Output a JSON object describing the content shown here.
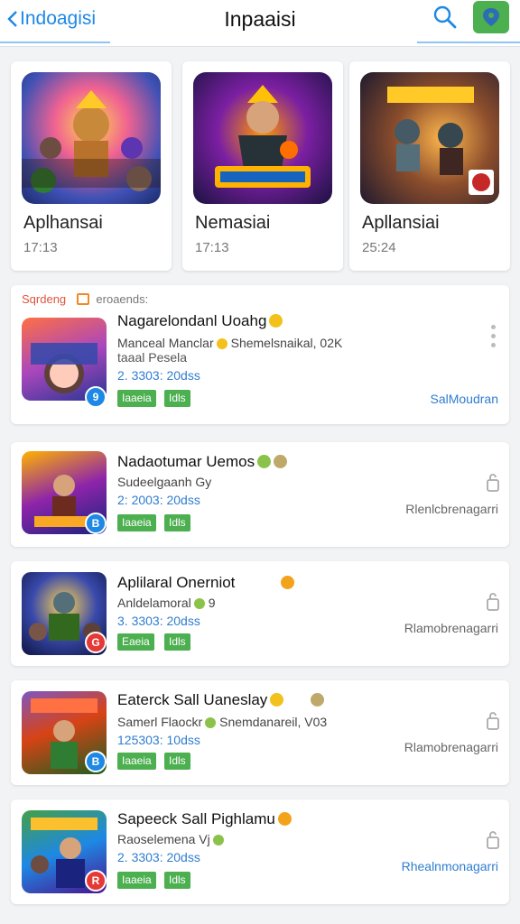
{
  "header": {
    "back_label": "Indoagisi",
    "title": "Inpaaisi"
  },
  "featured": [
    {
      "name": "Aplhansai",
      "time": "17:13",
      "art_text": "EOHEAVEN\nELSISISENS",
      "banner": "NIVS"
    },
    {
      "name": "Nemasiai",
      "time": "17:13",
      "art_text": "5INONISH",
      "banner": "ZIEBA"
    },
    {
      "name": "Apllansiai",
      "time": "25:24",
      "art_text": "UBRIUK",
      "banner": ""
    }
  ],
  "section": {
    "label": "Sqrdeng",
    "hint": "eroaends:"
  },
  "cards": [
    {
      "title": "Nagarelondanl Uoahg",
      "sub": "Manceal Manclar",
      "sub_b": "Shemelsnaikal, 02K",
      "sub2": "taaal Pesela",
      "meta": "2. 3303: 20dss",
      "tags": [
        "Iaaeia",
        "Idls"
      ],
      "action": "SalMoudran",
      "art_text": "NANBA\nANIMES",
      "badge": "9"
    },
    {
      "title": "Nadaotumar Uemos",
      "sub": "Sudeelgaanh",
      "sub_b": "Gy",
      "meta": "2: 2003: 20dss",
      "tags": [
        "Iaaeia",
        "Idls"
      ],
      "action": "Rlenlcbrenagarri",
      "art_text": "NAUSS",
      "badge": "B"
    },
    {
      "title": "Aplilaral Onerniot",
      "sub": "Anldelamoral",
      "sub_b": "9",
      "meta": "3. 3303: 20dss",
      "tags": [
        "Eaeia",
        "Idls"
      ],
      "action": "Rlamobrenagarri",
      "art_text": "",
      "badge": "G"
    },
    {
      "title": "Eaterck Sall Uaneslay",
      "sub": "Samerl Flaockr",
      "sub_b": "Snemdanareil, V03",
      "meta": "125303: 10dss",
      "tags": [
        "Iaaeia",
        "Idls"
      ],
      "action": "Rlamobrenagarri",
      "art_text": "BRAGUS",
      "badge": "B"
    },
    {
      "title": "Sapeeck Sall Pighlamu",
      "sub": "Raoselemena",
      "sub_b": "Vj",
      "meta": "2. 3303: 20dss",
      "tags": [
        "Iaaeia",
        "Idls"
      ],
      "action": "Rhealnmonagarri",
      "art_text": "BURRONS",
      "badge": "R"
    }
  ],
  "colors": {
    "accent": "#1e88e5",
    "tag_green": "#4caf50",
    "action_blue": "#2f7dd1"
  }
}
